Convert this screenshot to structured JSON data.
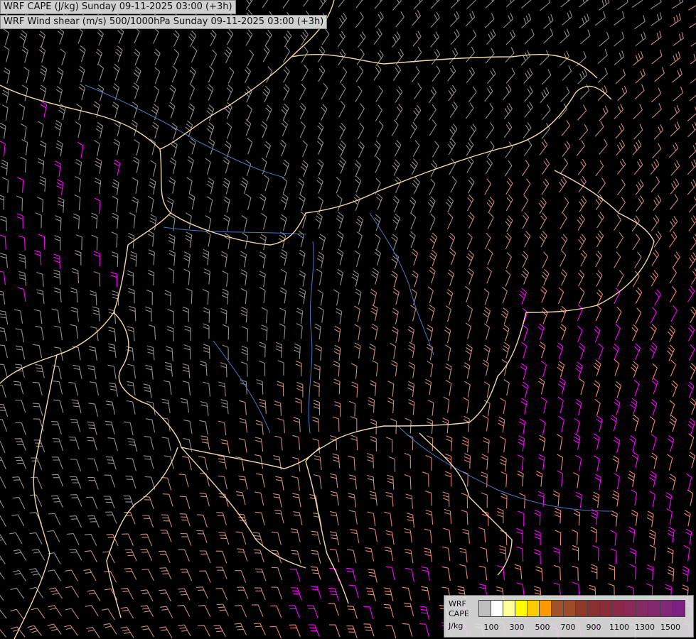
{
  "header": {
    "title_cape": "WRF CAPE (J/kg) Sunday 09-11-2025 03:00 (+3h)",
    "title_shear": "WRF Wind shear (m/s) 500/1000hPa Sunday 09-11-2025 03:00 (+3h)"
  },
  "legend": {
    "line1": "WRF",
    "line2": "CAPE",
    "line3": "J/kg",
    "colors": [
      "#bfbfbf",
      "#ffffff",
      "#ffff99",
      "#ffff00",
      "#ffcc00",
      "#ff9900",
      "#a0522d",
      "#9b4a2a",
      "#8b3a2a",
      "#8a3030",
      "#8a2c3a",
      "#8a2a48",
      "#882a55",
      "#862a62",
      "#84286f",
      "#82287a",
      "#7a2080"
    ],
    "ticks": [
      "100",
      "300",
      "500",
      "700",
      "900",
      "1100",
      "1300",
      "1500"
    ]
  },
  "map": {
    "background": "#000000",
    "border_color": "#f0d9a8",
    "river_color": "#4a78c0",
    "highlight_color": "#ff00ff"
  }
}
